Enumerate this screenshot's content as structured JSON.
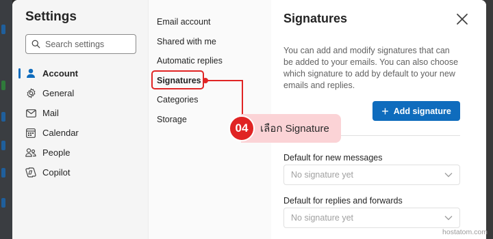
{
  "settings": {
    "title": "Settings",
    "search_placeholder": "Search settings",
    "nav": [
      {
        "label": "Account",
        "icon": "person-icon"
      },
      {
        "label": "General",
        "icon": "gear-icon"
      },
      {
        "label": "Mail",
        "icon": "mail-icon"
      },
      {
        "label": "Calendar",
        "icon": "calendar-icon"
      },
      {
        "label": "People",
        "icon": "people-icon"
      },
      {
        "label": "Copilot",
        "icon": "copilot-icon"
      }
    ]
  },
  "account_menu": {
    "items": [
      "Email account",
      "Shared with me",
      "Automatic replies",
      "Signatures",
      "Categories",
      "Storage"
    ],
    "selected": "Signatures"
  },
  "signatures": {
    "title": "Signatures",
    "description": "You can add and modify signatures that can be added to your emails. You can also choose which signature to add by default to your new emails and replies.",
    "add_button": "Add signature",
    "new_messages_label": "Default for new messages",
    "new_messages_value": "No signature yet",
    "replies_label": "Default for replies and forwards",
    "replies_value": "No signature yet"
  },
  "annotation": {
    "step": "04",
    "text": "เลือก Signature"
  },
  "watermark": "hostatom.com",
  "colors": {
    "accent": "#0f6cbd",
    "annotation": "#e02424",
    "annotation_fill": "#fbd3d6"
  }
}
